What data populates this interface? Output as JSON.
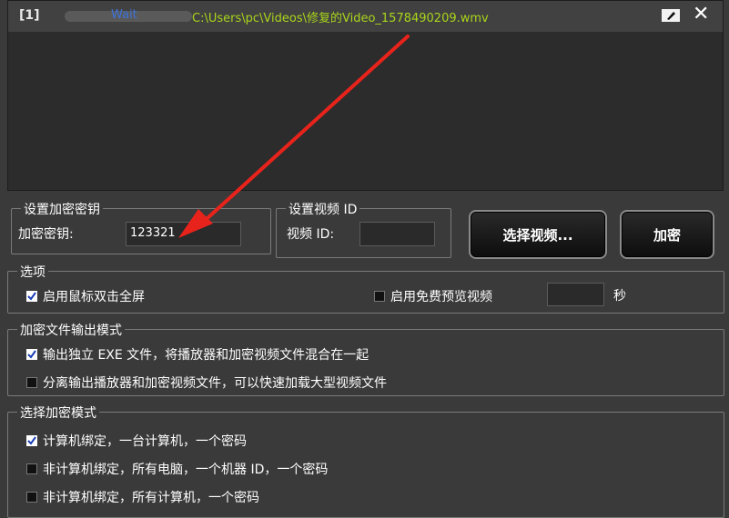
{
  "file_list": {
    "rows": [
      {
        "index": "[1]",
        "status": "Wait",
        "path": "C:\\Users\\pc\\Videos\\修复的Video_1578490209.wmv"
      }
    ]
  },
  "key_group": {
    "title": "设置加密密钥",
    "label": "加密密钥:",
    "value": "123321"
  },
  "video_id_group": {
    "title": "设置视频 ID",
    "label": "视频 ID:",
    "value": ""
  },
  "buttons": {
    "select_video": "选择视频...",
    "encrypt": "加密"
  },
  "options_group": {
    "title": "选项",
    "double_click_fullscreen": {
      "label": "启用鼠标双击全屏",
      "checked": true
    },
    "free_preview": {
      "label": "启用免费预览视频",
      "checked": false
    },
    "preview_seconds_value": "",
    "seconds_unit": "秒"
  },
  "output_mode_group": {
    "title": "加密文件输出模式",
    "options": [
      {
        "label": "输出独立 EXE 文件，将播放器和加密视频文件混合在一起",
        "checked": true
      },
      {
        "label": "分离输出播放器和加密视频文件，可以快速加载大型视频文件",
        "checked": false
      }
    ]
  },
  "encrypt_mode_group": {
    "title": "选择加密模式",
    "options": [
      {
        "label": "计算机绑定，一台计算机，一个密码",
        "checked": true
      },
      {
        "label": "非计算机绑定，所有电脑，一个机器 ID，一个密码",
        "checked": false
      },
      {
        "label": "非计算机绑定，所有计算机，一个密码",
        "checked": false
      }
    ]
  },
  "colors": {
    "status": "#3d72d8",
    "path": "#a9d51b",
    "annotation_arrow": "#e8231b"
  }
}
